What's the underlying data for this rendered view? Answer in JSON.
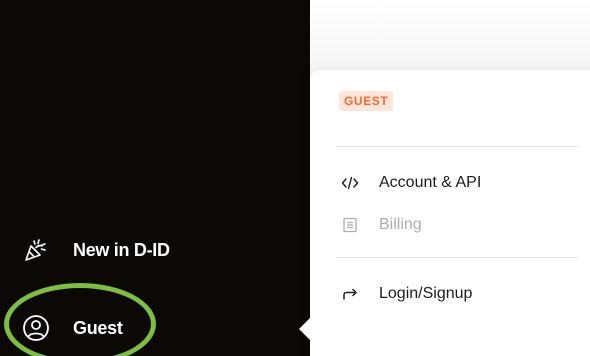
{
  "sidebar": {
    "items": [
      {
        "label": "New in D-ID",
        "icon": "party-popper-icon"
      },
      {
        "label": "Guest",
        "icon": "user-circle-icon"
      }
    ]
  },
  "menu": {
    "badge": "GUEST",
    "items": [
      {
        "label": "Account & API",
        "icon": "code-icon",
        "enabled": true
      },
      {
        "label": "Billing",
        "icon": "receipt-icon",
        "enabled": false
      },
      {
        "label": "Login/Signup",
        "icon": "login-arrow-icon",
        "enabled": true
      }
    ]
  },
  "colors": {
    "sidebar_bg": "#0b0806",
    "badge_text": "#f36a2c",
    "badge_bg": "#fde5da",
    "highlight": "#7bbf3c",
    "disabled_text": "#aeaeae"
  }
}
